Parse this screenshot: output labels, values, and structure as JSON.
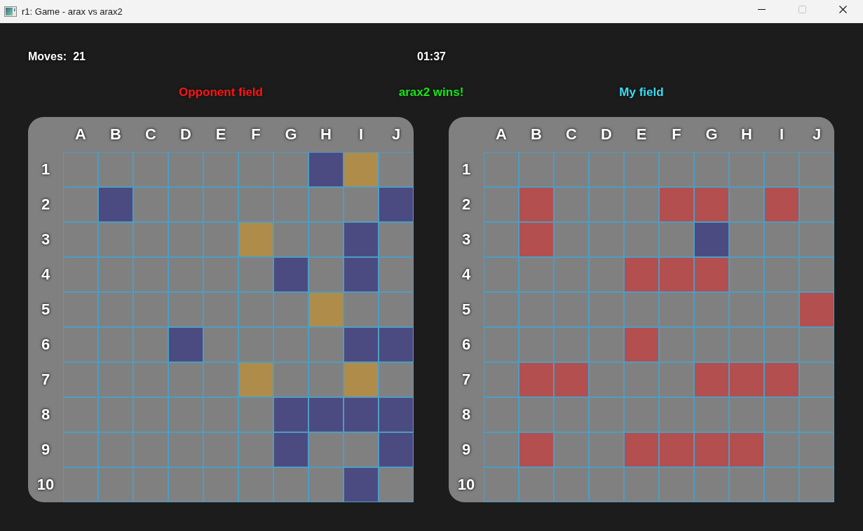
{
  "window": {
    "title": "r1: Game - arax vs arax2",
    "controls": [
      {
        "kind": "minimize",
        "disabled": false
      },
      {
        "kind": "maximize",
        "disabled": true
      },
      {
        "kind": "close",
        "disabled": false
      }
    ]
  },
  "moves": {
    "label": "Moves:",
    "value": "21"
  },
  "timer": "01:37",
  "result": "arax2 wins!",
  "boards": [
    {
      "kind": "opponent",
      "title": "Opponent field",
      "columns": [
        "A",
        "B",
        "C",
        "D",
        "E",
        "F",
        "G",
        "H",
        "I",
        "J"
      ],
      "rows": [
        {
          "label": "1",
          "cells": [
            {
              "color": "#808080"
            },
            {
              "color": "#808080"
            },
            {
              "color": "#808080"
            },
            {
              "color": "#808080"
            },
            {
              "color": "#808080"
            },
            {
              "color": "#808080"
            },
            {
              "color": "#808080"
            },
            {
              "color": "#4b4b82"
            },
            {
              "color": "#b08c4b"
            },
            {
              "color": "#808080"
            }
          ]
        },
        {
          "label": "2",
          "cells": [
            {
              "color": "#808080"
            },
            {
              "color": "#4b4b82"
            },
            {
              "color": "#808080"
            },
            {
              "color": "#808080"
            },
            {
              "color": "#808080"
            },
            {
              "color": "#808080"
            },
            {
              "color": "#808080"
            },
            {
              "color": "#808080"
            },
            {
              "color": "#808080"
            },
            {
              "color": "#4b4b82"
            }
          ]
        },
        {
          "label": "3",
          "cells": [
            {
              "color": "#808080"
            },
            {
              "color": "#808080"
            },
            {
              "color": "#808080"
            },
            {
              "color": "#808080"
            },
            {
              "color": "#808080"
            },
            {
              "color": "#b08c4b"
            },
            {
              "color": "#808080"
            },
            {
              "color": "#808080"
            },
            {
              "color": "#4b4b82"
            },
            {
              "color": "#808080"
            }
          ]
        },
        {
          "label": "4",
          "cells": [
            {
              "color": "#808080"
            },
            {
              "color": "#808080"
            },
            {
              "color": "#808080"
            },
            {
              "color": "#808080"
            },
            {
              "color": "#808080"
            },
            {
              "color": "#808080"
            },
            {
              "color": "#4b4b82"
            },
            {
              "color": "#808080"
            },
            {
              "color": "#4b4b82"
            },
            {
              "color": "#808080"
            }
          ]
        },
        {
          "label": "5",
          "cells": [
            {
              "color": "#808080"
            },
            {
              "color": "#808080"
            },
            {
              "color": "#808080"
            },
            {
              "color": "#808080"
            },
            {
              "color": "#808080"
            },
            {
              "color": "#808080"
            },
            {
              "color": "#808080"
            },
            {
              "color": "#b08c4b"
            },
            {
              "color": "#808080"
            },
            {
              "color": "#808080"
            }
          ]
        },
        {
          "label": "6",
          "cells": [
            {
              "color": "#808080"
            },
            {
              "color": "#808080"
            },
            {
              "color": "#808080"
            },
            {
              "color": "#4b4b82"
            },
            {
              "color": "#808080"
            },
            {
              "color": "#808080"
            },
            {
              "color": "#808080"
            },
            {
              "color": "#808080"
            },
            {
              "color": "#4b4b82"
            },
            {
              "color": "#4b4b82"
            }
          ]
        },
        {
          "label": "7",
          "cells": [
            {
              "color": "#808080"
            },
            {
              "color": "#808080"
            },
            {
              "color": "#808080"
            },
            {
              "color": "#808080"
            },
            {
              "color": "#808080"
            },
            {
              "color": "#b08c4b"
            },
            {
              "color": "#808080"
            },
            {
              "color": "#808080"
            },
            {
              "color": "#b08c4b"
            },
            {
              "color": "#808080"
            }
          ]
        },
        {
          "label": "8",
          "cells": [
            {
              "color": "#808080"
            },
            {
              "color": "#808080"
            },
            {
              "color": "#808080"
            },
            {
              "color": "#808080"
            },
            {
              "color": "#808080"
            },
            {
              "color": "#808080"
            },
            {
              "color": "#4b4b82"
            },
            {
              "color": "#4b4b82"
            },
            {
              "color": "#4b4b82"
            },
            {
              "color": "#4b4b82"
            }
          ]
        },
        {
          "label": "9",
          "cells": [
            {
              "color": "#808080"
            },
            {
              "color": "#808080"
            },
            {
              "color": "#808080"
            },
            {
              "color": "#808080"
            },
            {
              "color": "#808080"
            },
            {
              "color": "#808080"
            },
            {
              "color": "#4b4b82"
            },
            {
              "color": "#808080"
            },
            {
              "color": "#808080"
            },
            {
              "color": "#4b4b82"
            }
          ]
        },
        {
          "label": "10",
          "cells": [
            {
              "color": "#808080"
            },
            {
              "color": "#808080"
            },
            {
              "color": "#808080"
            },
            {
              "color": "#808080"
            },
            {
              "color": "#808080"
            },
            {
              "color": "#808080"
            },
            {
              "color": "#808080"
            },
            {
              "color": "#808080"
            },
            {
              "color": "#4b4b82"
            },
            {
              "color": "#808080"
            }
          ]
        }
      ]
    },
    {
      "kind": "own",
      "title": "My field",
      "columns": [
        "A",
        "B",
        "C",
        "D",
        "E",
        "F",
        "G",
        "H",
        "I",
        "J"
      ],
      "rows": [
        {
          "label": "1",
          "cells": [
            {
              "color": "#808080"
            },
            {
              "color": "#808080"
            },
            {
              "color": "#808080"
            },
            {
              "color": "#808080"
            },
            {
              "color": "#808080"
            },
            {
              "color": "#808080"
            },
            {
              "color": "#808080"
            },
            {
              "color": "#808080"
            },
            {
              "color": "#808080"
            },
            {
              "color": "#808080"
            }
          ]
        },
        {
          "label": "2",
          "cells": [
            {
              "color": "#808080"
            },
            {
              "color": "#b34f4f"
            },
            {
              "color": "#808080"
            },
            {
              "color": "#808080"
            },
            {
              "color": "#808080"
            },
            {
              "color": "#b34f4f"
            },
            {
              "color": "#b34f4f"
            },
            {
              "color": "#808080"
            },
            {
              "color": "#b34f4f"
            },
            {
              "color": "#808080"
            }
          ]
        },
        {
          "label": "3",
          "cells": [
            {
              "color": "#808080"
            },
            {
              "color": "#b34f4f"
            },
            {
              "color": "#808080"
            },
            {
              "color": "#808080"
            },
            {
              "color": "#808080"
            },
            {
              "color": "#808080"
            },
            {
              "color": "#4b4b82"
            },
            {
              "color": "#808080"
            },
            {
              "color": "#808080"
            },
            {
              "color": "#808080"
            }
          ]
        },
        {
          "label": "4",
          "cells": [
            {
              "color": "#808080"
            },
            {
              "color": "#808080"
            },
            {
              "color": "#808080"
            },
            {
              "color": "#808080"
            },
            {
              "color": "#b34f4f"
            },
            {
              "color": "#b34f4f"
            },
            {
              "color": "#b34f4f"
            },
            {
              "color": "#808080"
            },
            {
              "color": "#808080"
            },
            {
              "color": "#808080"
            }
          ]
        },
        {
          "label": "5",
          "cells": [
            {
              "color": "#808080"
            },
            {
              "color": "#808080"
            },
            {
              "color": "#808080"
            },
            {
              "color": "#808080"
            },
            {
              "color": "#808080"
            },
            {
              "color": "#808080"
            },
            {
              "color": "#808080"
            },
            {
              "color": "#808080"
            },
            {
              "color": "#808080"
            },
            {
              "color": "#b34f4f"
            }
          ]
        },
        {
          "label": "6",
          "cells": [
            {
              "color": "#808080"
            },
            {
              "color": "#808080"
            },
            {
              "color": "#808080"
            },
            {
              "color": "#808080"
            },
            {
              "color": "#b34f4f"
            },
            {
              "color": "#808080"
            },
            {
              "color": "#808080"
            },
            {
              "color": "#808080"
            },
            {
              "color": "#808080"
            },
            {
              "color": "#808080"
            }
          ]
        },
        {
          "label": "7",
          "cells": [
            {
              "color": "#808080"
            },
            {
              "color": "#b34f4f"
            },
            {
              "color": "#b34f4f"
            },
            {
              "color": "#808080"
            },
            {
              "color": "#808080"
            },
            {
              "color": "#808080"
            },
            {
              "color": "#b34f4f"
            },
            {
              "color": "#b34f4f"
            },
            {
              "color": "#b34f4f"
            },
            {
              "color": "#808080"
            }
          ]
        },
        {
          "label": "8",
          "cells": [
            {
              "color": "#808080"
            },
            {
              "color": "#808080"
            },
            {
              "color": "#808080"
            },
            {
              "color": "#808080"
            },
            {
              "color": "#808080"
            },
            {
              "color": "#808080"
            },
            {
              "color": "#808080"
            },
            {
              "color": "#808080"
            },
            {
              "color": "#808080"
            },
            {
              "color": "#808080"
            }
          ]
        },
        {
          "label": "9",
          "cells": [
            {
              "color": "#808080"
            },
            {
              "color": "#b34f4f"
            },
            {
              "color": "#808080"
            },
            {
              "color": "#808080"
            },
            {
              "color": "#b34f4f"
            },
            {
              "color": "#b34f4f"
            },
            {
              "color": "#b34f4f"
            },
            {
              "color": "#b34f4f"
            },
            {
              "color": "#808080"
            },
            {
              "color": "#808080"
            }
          ]
        },
        {
          "label": "10",
          "cells": [
            {
              "color": "#808080"
            },
            {
              "color": "#808080"
            },
            {
              "color": "#808080"
            },
            {
              "color": "#808080"
            },
            {
              "color": "#808080"
            },
            {
              "color": "#808080"
            },
            {
              "color": "#808080"
            },
            {
              "color": "#808080"
            },
            {
              "color": "#808080"
            },
            {
              "color": "#808080"
            }
          ]
        }
      ]
    }
  ]
}
